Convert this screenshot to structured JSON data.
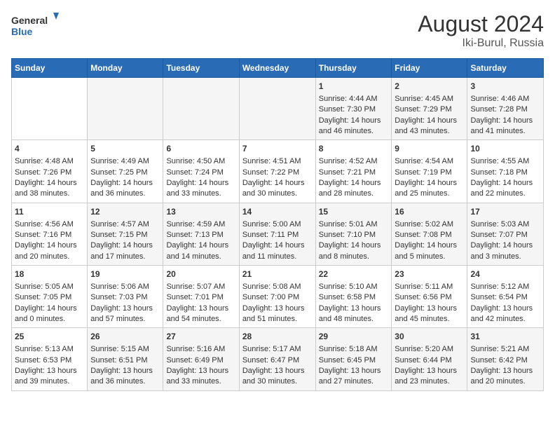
{
  "logo": {
    "line1": "General",
    "line2": "Blue"
  },
  "title": "August 2024",
  "subtitle": "Iki-Burul, Russia",
  "days_of_week": [
    "Sunday",
    "Monday",
    "Tuesday",
    "Wednesday",
    "Thursday",
    "Friday",
    "Saturday"
  ],
  "weeks": [
    [
      {
        "day": "",
        "data": ""
      },
      {
        "day": "",
        "data": ""
      },
      {
        "day": "",
        "data": ""
      },
      {
        "day": "",
        "data": ""
      },
      {
        "day": "1",
        "data": "Sunrise: 4:44 AM\nSunset: 7:30 PM\nDaylight: 14 hours and 46 minutes."
      },
      {
        "day": "2",
        "data": "Sunrise: 4:45 AM\nSunset: 7:29 PM\nDaylight: 14 hours and 43 minutes."
      },
      {
        "day": "3",
        "data": "Sunrise: 4:46 AM\nSunset: 7:28 PM\nDaylight: 14 hours and 41 minutes."
      }
    ],
    [
      {
        "day": "4",
        "data": "Sunrise: 4:48 AM\nSunset: 7:26 PM\nDaylight: 14 hours and 38 minutes."
      },
      {
        "day": "5",
        "data": "Sunrise: 4:49 AM\nSunset: 7:25 PM\nDaylight: 14 hours and 36 minutes."
      },
      {
        "day": "6",
        "data": "Sunrise: 4:50 AM\nSunset: 7:24 PM\nDaylight: 14 hours and 33 minutes."
      },
      {
        "day": "7",
        "data": "Sunrise: 4:51 AM\nSunset: 7:22 PM\nDaylight: 14 hours and 30 minutes."
      },
      {
        "day": "8",
        "data": "Sunrise: 4:52 AM\nSunset: 7:21 PM\nDaylight: 14 hours and 28 minutes."
      },
      {
        "day": "9",
        "data": "Sunrise: 4:54 AM\nSunset: 7:19 PM\nDaylight: 14 hours and 25 minutes."
      },
      {
        "day": "10",
        "data": "Sunrise: 4:55 AM\nSunset: 7:18 PM\nDaylight: 14 hours and 22 minutes."
      }
    ],
    [
      {
        "day": "11",
        "data": "Sunrise: 4:56 AM\nSunset: 7:16 PM\nDaylight: 14 hours and 20 minutes."
      },
      {
        "day": "12",
        "data": "Sunrise: 4:57 AM\nSunset: 7:15 PM\nDaylight: 14 hours and 17 minutes."
      },
      {
        "day": "13",
        "data": "Sunrise: 4:59 AM\nSunset: 7:13 PM\nDaylight: 14 hours and 14 minutes."
      },
      {
        "day": "14",
        "data": "Sunrise: 5:00 AM\nSunset: 7:11 PM\nDaylight: 14 hours and 11 minutes."
      },
      {
        "day": "15",
        "data": "Sunrise: 5:01 AM\nSunset: 7:10 PM\nDaylight: 14 hours and 8 minutes."
      },
      {
        "day": "16",
        "data": "Sunrise: 5:02 AM\nSunset: 7:08 PM\nDaylight: 14 hours and 5 minutes."
      },
      {
        "day": "17",
        "data": "Sunrise: 5:03 AM\nSunset: 7:07 PM\nDaylight: 14 hours and 3 minutes."
      }
    ],
    [
      {
        "day": "18",
        "data": "Sunrise: 5:05 AM\nSunset: 7:05 PM\nDaylight: 14 hours and 0 minutes."
      },
      {
        "day": "19",
        "data": "Sunrise: 5:06 AM\nSunset: 7:03 PM\nDaylight: 13 hours and 57 minutes."
      },
      {
        "day": "20",
        "data": "Sunrise: 5:07 AM\nSunset: 7:01 PM\nDaylight: 13 hours and 54 minutes."
      },
      {
        "day": "21",
        "data": "Sunrise: 5:08 AM\nSunset: 7:00 PM\nDaylight: 13 hours and 51 minutes."
      },
      {
        "day": "22",
        "data": "Sunrise: 5:10 AM\nSunset: 6:58 PM\nDaylight: 13 hours and 48 minutes."
      },
      {
        "day": "23",
        "data": "Sunrise: 5:11 AM\nSunset: 6:56 PM\nDaylight: 13 hours and 45 minutes."
      },
      {
        "day": "24",
        "data": "Sunrise: 5:12 AM\nSunset: 6:54 PM\nDaylight: 13 hours and 42 minutes."
      }
    ],
    [
      {
        "day": "25",
        "data": "Sunrise: 5:13 AM\nSunset: 6:53 PM\nDaylight: 13 hours and 39 minutes."
      },
      {
        "day": "26",
        "data": "Sunrise: 5:15 AM\nSunset: 6:51 PM\nDaylight: 13 hours and 36 minutes."
      },
      {
        "day": "27",
        "data": "Sunrise: 5:16 AM\nSunset: 6:49 PM\nDaylight: 13 hours and 33 minutes."
      },
      {
        "day": "28",
        "data": "Sunrise: 5:17 AM\nSunset: 6:47 PM\nDaylight: 13 hours and 30 minutes."
      },
      {
        "day": "29",
        "data": "Sunrise: 5:18 AM\nSunset: 6:45 PM\nDaylight: 13 hours and 27 minutes."
      },
      {
        "day": "30",
        "data": "Sunrise: 5:20 AM\nSunset: 6:44 PM\nDaylight: 13 hours and 23 minutes."
      },
      {
        "day": "31",
        "data": "Sunrise: 5:21 AM\nSunset: 6:42 PM\nDaylight: 13 hours and 20 minutes."
      }
    ]
  ]
}
